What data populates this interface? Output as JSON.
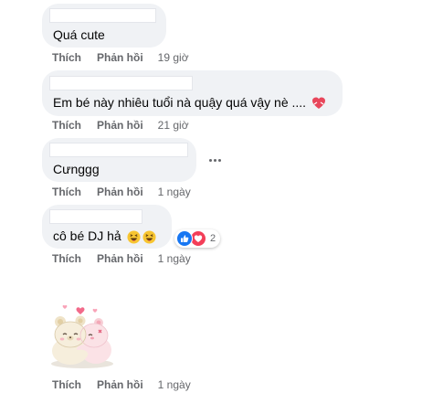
{
  "comments": [
    {
      "text": "Quá cute",
      "like_label": "Thích",
      "reply_label": "Phản hồi",
      "time": "19 giờ"
    },
    {
      "text": "Em bé này nhiêu tuổi nà quậy quá vậy nè ....",
      "like_label": "Thích",
      "reply_label": "Phản hồi",
      "time": "21 giờ"
    },
    {
      "text": "Cưnggg",
      "like_label": "Thích",
      "reply_label": "Phản hồi",
      "time": "1 ngày"
    },
    {
      "text": "cô bé DJ hả",
      "like_label": "Thích",
      "reply_label": "Phản hồi",
      "time": "1 ngày",
      "reaction_count": "2"
    },
    {
      "sticker": "teddy-bears-hugging-sticker",
      "like_label": "Thích",
      "reply_label": "Phản hồi",
      "time": "1 ngày"
    }
  ],
  "colors": {
    "bubble": "#f0f2f5",
    "meta_text": "#65676b",
    "like_blue": "#1877f2",
    "love_red": "#f33e58"
  }
}
